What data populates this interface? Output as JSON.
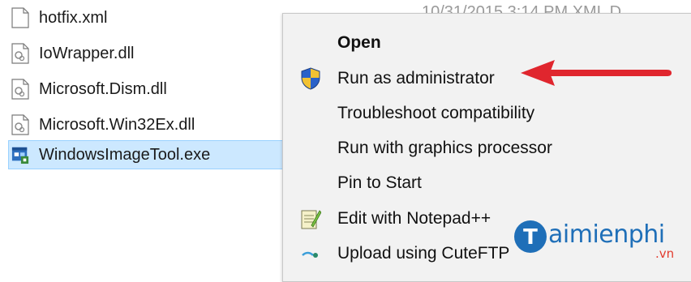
{
  "files": [
    {
      "name": "hotfix.xml",
      "icon": "xml-file-icon",
      "meta": "10/31/2015 3:14 PM    XML D"
    },
    {
      "name": "IoWrapper.dll",
      "icon": "dll-file-icon"
    },
    {
      "name": "Microsoft.Dism.dll",
      "icon": "dll-file-icon"
    },
    {
      "name": "Microsoft.Win32Ex.dll",
      "icon": "dll-file-icon"
    },
    {
      "name": "WindowsImageTool.exe",
      "icon": "exe-file-icon",
      "selected": true
    }
  ],
  "context_menu": {
    "items": [
      {
        "label": "Open",
        "bold": true
      },
      {
        "label": "Run as administrator",
        "icon": "uac-shield-icon"
      },
      {
        "label": "Troubleshoot compatibility"
      },
      {
        "label": "Run with graphics processor"
      },
      {
        "label": "Pin to Start"
      },
      {
        "label": "Edit with Notepad++",
        "icon": "notepad-plus-plus-icon"
      },
      {
        "label": "Upload using CuteFTP",
        "icon": "cuteftp-icon"
      }
    ]
  },
  "annotation": {
    "arrow_color": "#e0262e",
    "arrow_icon": "red-arrow-left-icon"
  },
  "watermark": {
    "text": "aimienphi",
    "suffix": ".vn",
    "logo_letter": "T"
  },
  "colors": {
    "selection_bg": "#cce8ff",
    "menu_bg": "#f2f2f2",
    "watermark_blue": "#1f6fb8"
  }
}
